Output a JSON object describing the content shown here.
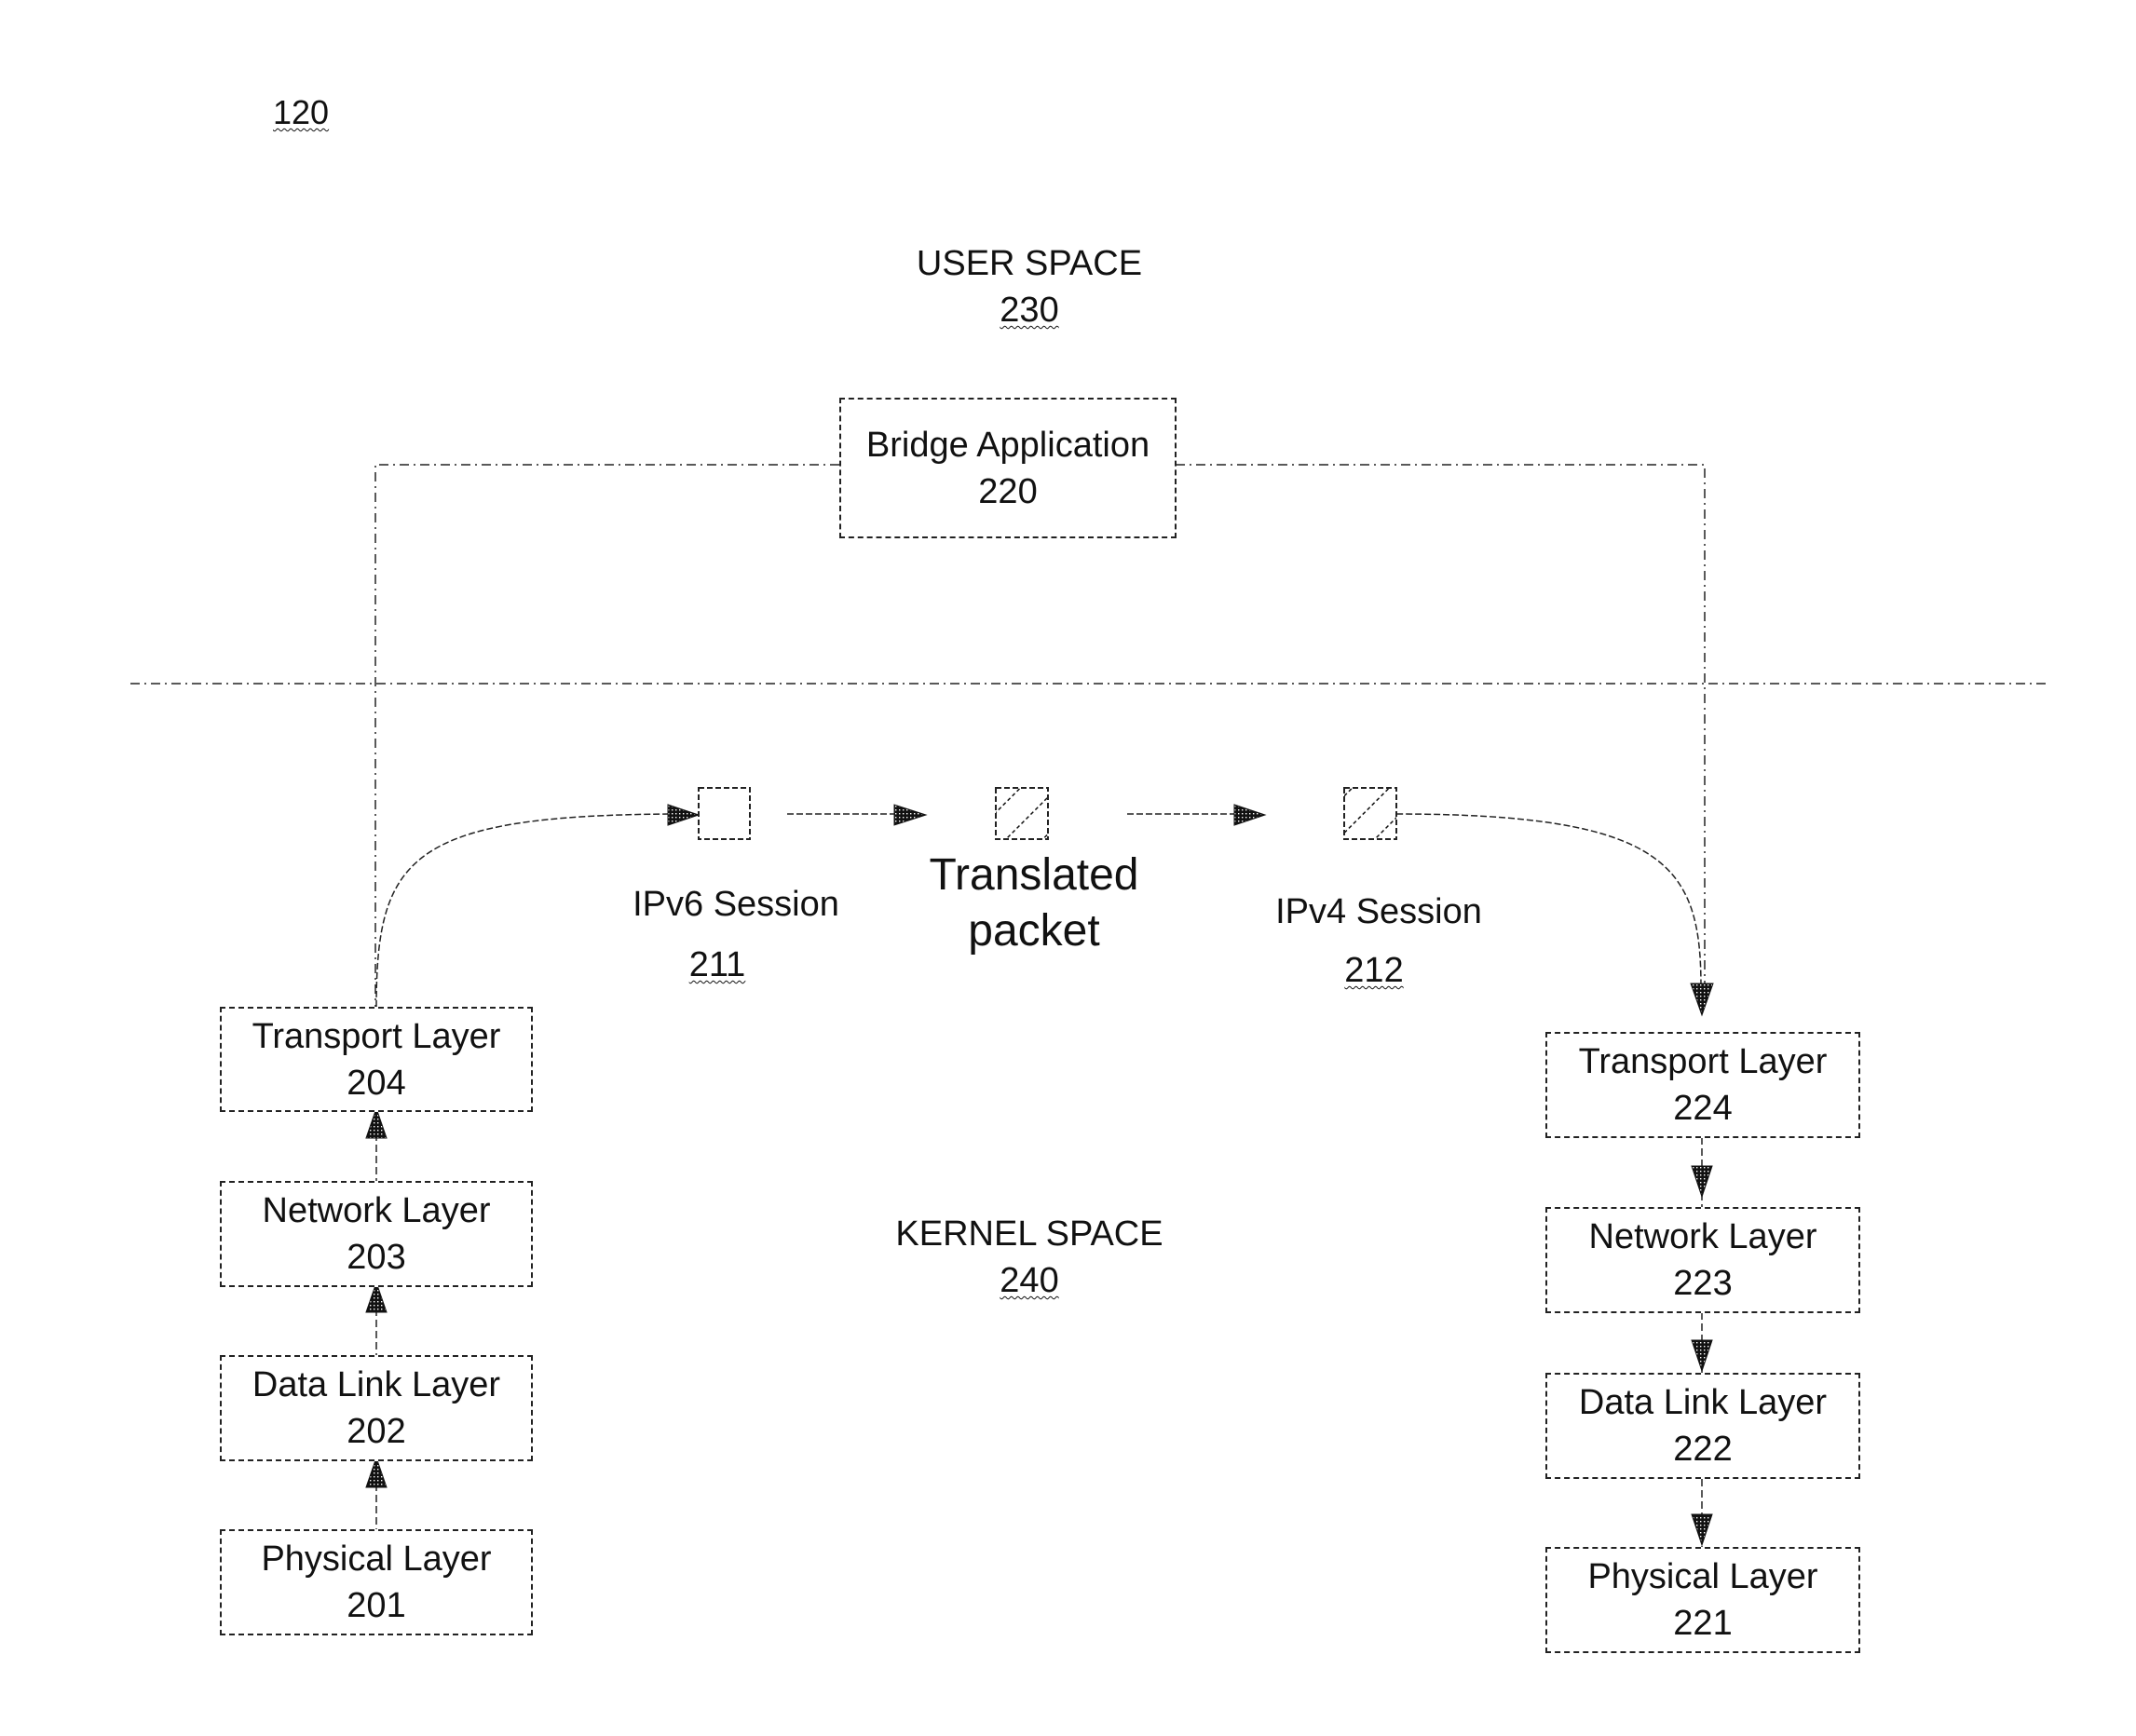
{
  "figure": {
    "reference": "120"
  },
  "user_space": {
    "title": "USER SPACE",
    "ref": "230"
  },
  "kernel_space": {
    "title": "KERNEL SPACE",
    "ref": "240"
  },
  "bridge_application": {
    "label": "Bridge Application",
    "ref": "220"
  },
  "left_stack": [
    {
      "label": "Transport Layer",
      "ref": "204"
    },
    {
      "label": "Network Layer",
      "ref": "203"
    },
    {
      "label": "Data Link Layer",
      "ref": "202"
    },
    {
      "label": "Physical Layer",
      "ref": "201"
    }
  ],
  "right_stack": [
    {
      "label": "Transport Layer",
      "ref": "224"
    },
    {
      "label": "Network Layer",
      "ref": "223"
    },
    {
      "label": "Data Link Layer",
      "ref": "222"
    },
    {
      "label": "Physical Layer",
      "ref": "221"
    }
  ],
  "ipv6_session": {
    "label": "IPv6 Session",
    "ref": "211",
    "pattern": "empty"
  },
  "translated_packet": {
    "label_line1": "Translated",
    "label_line2": "packet",
    "pattern": "hatched"
  },
  "ipv4_session": {
    "label": "IPv4 Session",
    "ref": "212",
    "pattern": "hatched"
  },
  "colors": {
    "ink": "#111111",
    "background": "#ffffff"
  }
}
